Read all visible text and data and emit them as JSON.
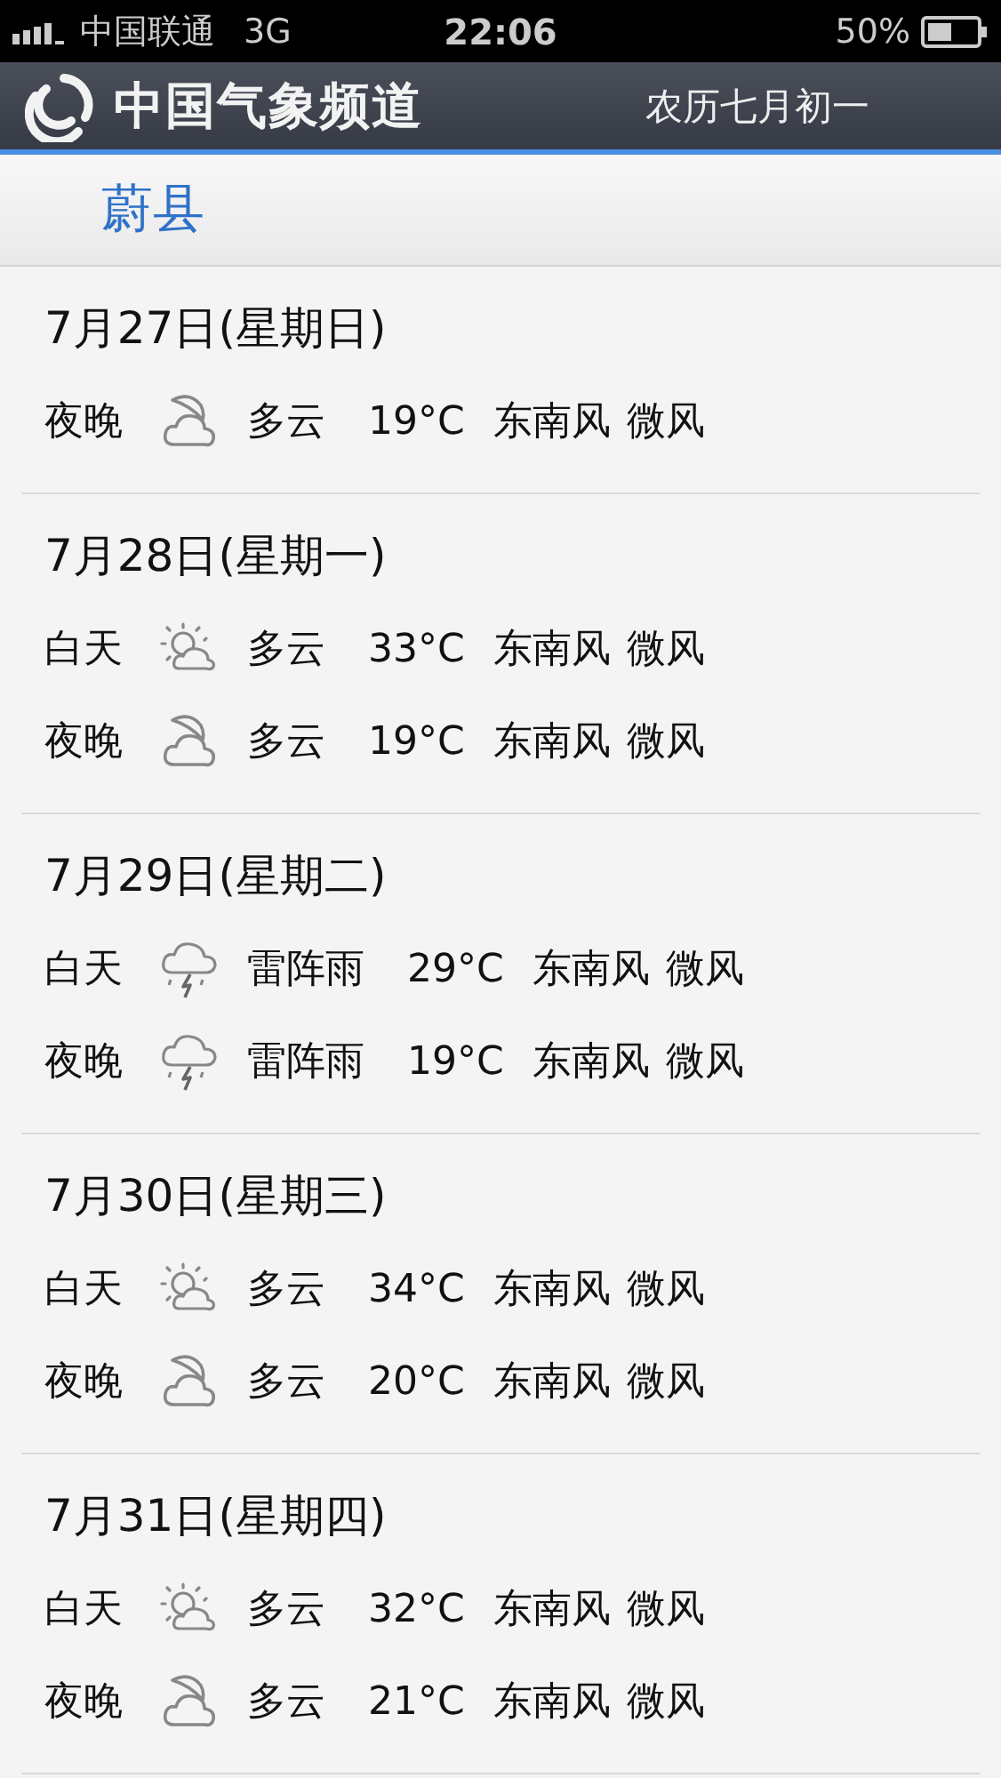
{
  "status_bar": {
    "carrier": "中国联通",
    "network": "3G",
    "time": "22:06",
    "battery": "50%"
  },
  "header": {
    "logo_text": "中国气象频道",
    "lunar_date": "农历七月初一"
  },
  "city": "蔚县",
  "days": [
    {
      "date": "7月27日(星期日)",
      "periods": [
        {
          "period": "夜晚",
          "kind": "night",
          "condition": "多云",
          "temp": "19°C",
          "wind_dir": "东南风",
          "wind_force": "微风"
        }
      ]
    },
    {
      "date": "7月28日(星期一)",
      "periods": [
        {
          "period": "白天",
          "kind": "day",
          "condition": "多云",
          "temp": "33°C",
          "wind_dir": "东南风",
          "wind_force": "微风"
        },
        {
          "period": "夜晚",
          "kind": "night",
          "condition": "多云",
          "temp": "19°C",
          "wind_dir": "东南风",
          "wind_force": "微风"
        }
      ]
    },
    {
      "date": "7月29日(星期二)",
      "periods": [
        {
          "period": "白天",
          "kind": "storm",
          "condition": "雷阵雨",
          "temp": "29°C",
          "wind_dir": "东南风",
          "wind_force": "微风"
        },
        {
          "period": "夜晚",
          "kind": "storm",
          "condition": "雷阵雨",
          "temp": "19°C",
          "wind_dir": "东南风",
          "wind_force": "微风"
        }
      ]
    },
    {
      "date": "7月30日(星期三)",
      "periods": [
        {
          "period": "白天",
          "kind": "day",
          "condition": "多云",
          "temp": "34°C",
          "wind_dir": "东南风",
          "wind_force": "微风"
        },
        {
          "period": "夜晚",
          "kind": "night",
          "condition": "多云",
          "temp": "20°C",
          "wind_dir": "东南风",
          "wind_force": "微风"
        }
      ]
    },
    {
      "date": "7月31日(星期四)",
      "periods": [
        {
          "period": "白天",
          "kind": "day",
          "condition": "多云",
          "temp": "32°C",
          "wind_dir": "东南风",
          "wind_force": "微风"
        },
        {
          "period": "夜晚",
          "kind": "night",
          "condition": "多云",
          "temp": "21°C",
          "wind_dir": "东南风",
          "wind_force": "微风"
        }
      ]
    }
  ]
}
